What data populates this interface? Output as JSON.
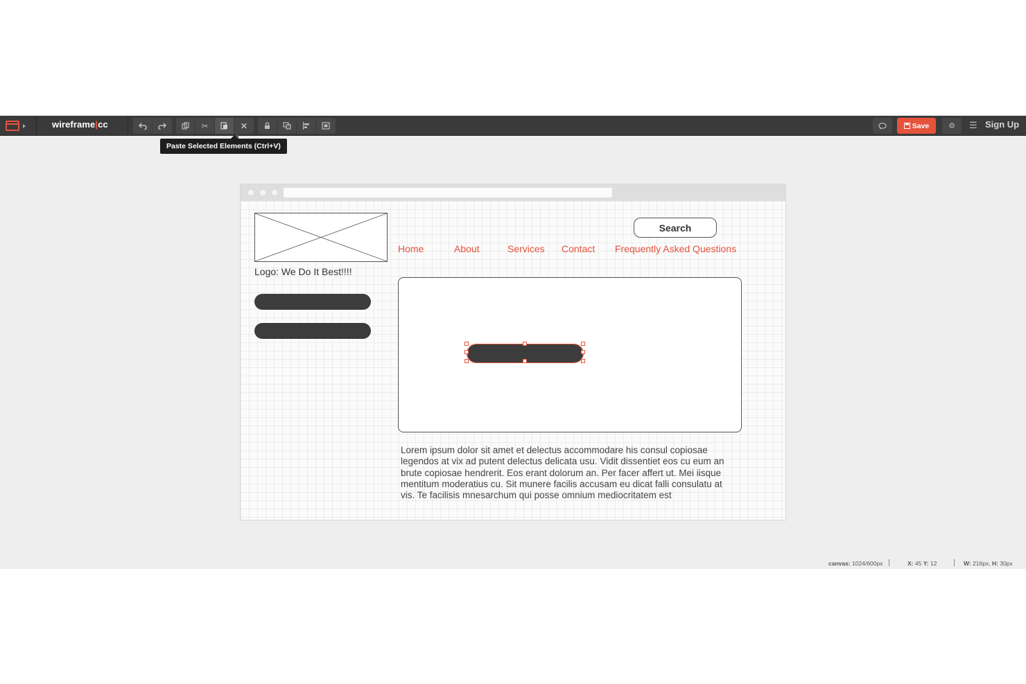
{
  "app": {
    "name_part1": "wireframe",
    "name_part2": "cc"
  },
  "toolbar": {
    "undo_icon": "undo-icon",
    "redo_icon": "redo-icon",
    "copy_icon": "copy-icon",
    "cut_icon": "scissors-icon",
    "paste_icon": "paste-icon",
    "delete_icon": "close-icon",
    "lock_icon": "lock-icon",
    "arrange_icon": "arrange-icon",
    "align_icon": "align-icon",
    "group_icon": "group-icon",
    "tooltip": "Paste Selected Elements (Ctrl+V)",
    "save_label": "Save",
    "signup_label": "Sign Up",
    "accent_color": "#e5533d"
  },
  "wireframe": {
    "logo_caption": "Logo: We Do It Best!!!!",
    "search_label": "Search",
    "nav": [
      "Home",
      "About",
      "Services",
      "Contact",
      "Frequently Asked Questions"
    ],
    "body_text": "Lorem ipsum dolor sit amet et delectus accommodare his consul copiosae legendos at vix ad putent delectus delicata usu. Vidit dissentiet eos cu eum an brute copiosae hendrerit. Eos erant dolorum an. Per facer affert ut. Mei iisque mentitum moderatius cu. Sit munere facilis accusam eu dicat falli consulatu at vis. Te facilisis mnesarchum qui posse omnium mediocritatem est"
  },
  "status": {
    "canvas_label": "canvas:",
    "canvas_value": "1024/600px",
    "x_label": "X:",
    "x_value": "45",
    "y_label": "Y:",
    "y_value": "12",
    "w_label": "W:",
    "w_value": "216px,",
    "h_label": "H:",
    "h_value": "30px"
  }
}
